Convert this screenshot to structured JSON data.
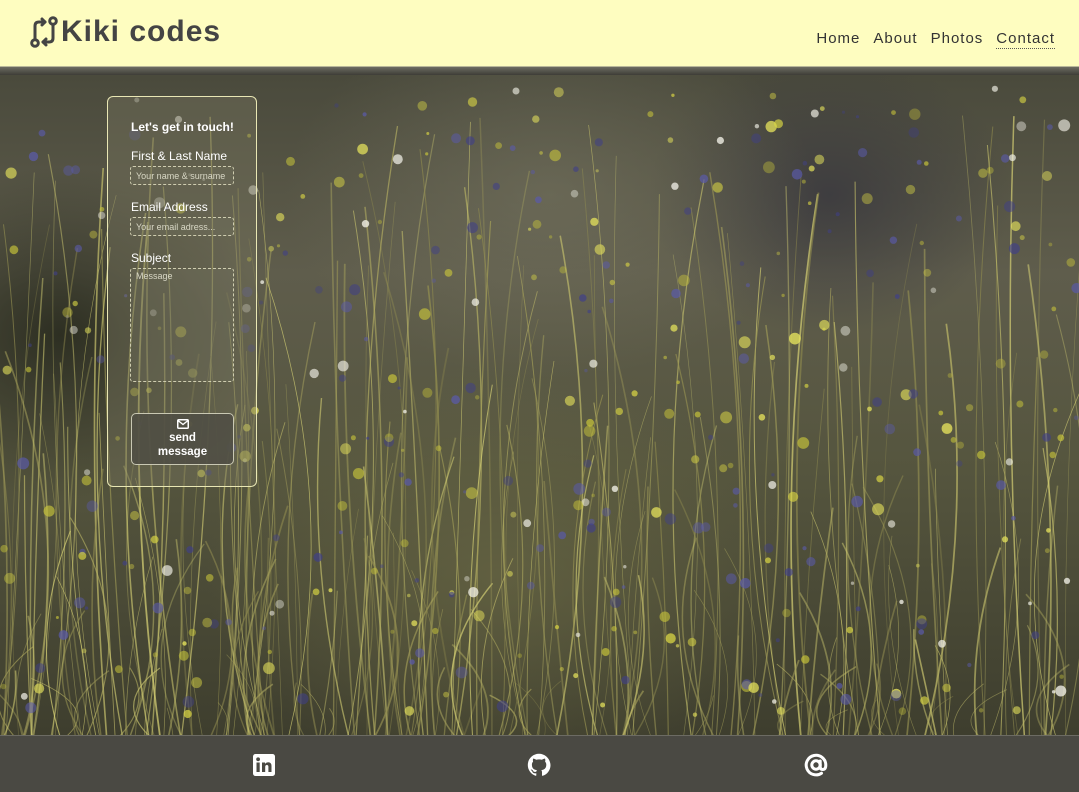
{
  "header": {
    "logo_text": "Kiki codes",
    "logo_icon": "code-branch-icon",
    "nav": [
      {
        "label": "Home",
        "active": false
      },
      {
        "label": "About",
        "active": false
      },
      {
        "label": "Photos",
        "active": false
      },
      {
        "label": "Contact",
        "active": true
      }
    ]
  },
  "background": {
    "description_icon": "wildflower-meadow-photo"
  },
  "contact_form": {
    "title": "Let's get in touch!",
    "name_label": "First & Last Name",
    "name_placeholder": "Your name & surname",
    "email_label": "Email Address",
    "email_placeholder": "Your email adress...",
    "subject_label": "Subject",
    "subject_placeholder": "Message",
    "send_icon": "envelope-icon",
    "send_label_line1": "send",
    "send_label_line2": "message"
  },
  "footer": {
    "links": [
      {
        "icon": "linkedin-icon"
      },
      {
        "icon": "github-icon"
      },
      {
        "icon": "at-sign-icon"
      }
    ]
  },
  "colors": {
    "header_bg": "#fefdc0",
    "footer_bg": "#4a4943",
    "card_border": "#e9e7b4",
    "text_dark": "#444444"
  }
}
